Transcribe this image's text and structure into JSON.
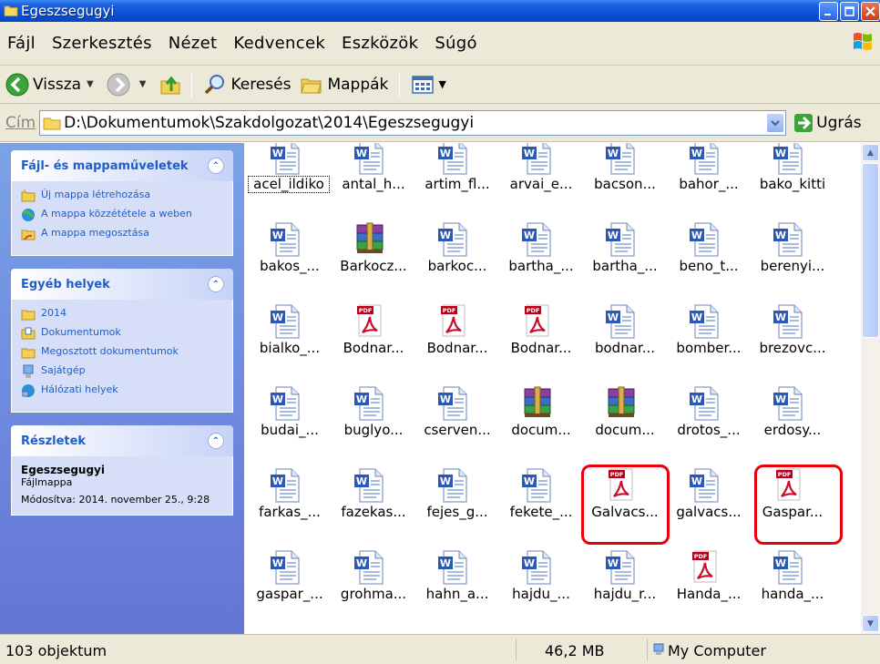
{
  "window": {
    "title": "Egeszsegugyi"
  },
  "menu": [
    "Fájl",
    "Szerkesztés",
    "Nézet",
    "Kedvencek",
    "Eszközök",
    "Súgó"
  ],
  "toolbar": {
    "back": "Vissza",
    "search": "Keresés",
    "folders": "Mappák"
  },
  "address": {
    "label": "Cím",
    "path": "D:\\Dokumentumok\\Szakdolgozat\\2014\\Egeszsegugyi",
    "go": "Ugrás"
  },
  "panels": {
    "tasks": {
      "title": "Fájl- és mappaműveletek",
      "items": [
        "Új mappa létrehozása",
        "A mappa közzététele a weben",
        "A mappa megosztása"
      ]
    },
    "places": {
      "title": "Egyéb helyek",
      "items": [
        "2014",
        "Dokumentumok",
        "Megosztott dokumentumok",
        "Sajátgép",
        "Hálózati helyek"
      ]
    },
    "details": {
      "title": "Részletek",
      "name": "Egeszsegugyi",
      "type": "Fájlmappa",
      "modified": "Módosítva: 2014. november 25., 9:28"
    }
  },
  "files": [
    {
      "name": "acel_ildiko",
      "type": "word"
    },
    {
      "name": "antal_h...",
      "type": "word"
    },
    {
      "name": "artim_fl...",
      "type": "word"
    },
    {
      "name": "arvai_e...",
      "type": "word"
    },
    {
      "name": "bacson...",
      "type": "word"
    },
    {
      "name": "bahor_...",
      "type": "word"
    },
    {
      "name": "bako_kitti",
      "type": "word"
    },
    {
      "name": "bakos_...",
      "type": "word"
    },
    {
      "name": "Barkocz...",
      "type": "rar"
    },
    {
      "name": "barkoc...",
      "type": "word"
    },
    {
      "name": "bartha_...",
      "type": "word"
    },
    {
      "name": "bartha_...",
      "type": "word"
    },
    {
      "name": "beno_t...",
      "type": "word"
    },
    {
      "name": "berenyi...",
      "type": "word"
    },
    {
      "name": "bialko_...",
      "type": "word"
    },
    {
      "name": "Bodnar...",
      "type": "pdf"
    },
    {
      "name": "Bodnar...",
      "type": "pdf"
    },
    {
      "name": "Bodnar...",
      "type": "pdf"
    },
    {
      "name": "bodnar...",
      "type": "word"
    },
    {
      "name": "bomber...",
      "type": "word"
    },
    {
      "name": "brezovc...",
      "type": "word"
    },
    {
      "name": "budai_...",
      "type": "word"
    },
    {
      "name": "buglyo...",
      "type": "word"
    },
    {
      "name": "cserven...",
      "type": "word"
    },
    {
      "name": "docum...",
      "type": "rar"
    },
    {
      "name": "docum...",
      "type": "rar"
    },
    {
      "name": "drotos_...",
      "type": "word"
    },
    {
      "name": "erdosy...",
      "type": "word"
    },
    {
      "name": "farkas_...",
      "type": "word"
    },
    {
      "name": "fazekas...",
      "type": "word"
    },
    {
      "name": "fejes_g...",
      "type": "word"
    },
    {
      "name": "fekete_...",
      "type": "word"
    },
    {
      "name": "Galvacs...",
      "type": "pdf"
    },
    {
      "name": "galvacs...",
      "type": "word"
    },
    {
      "name": "Gaspar...",
      "type": "pdf"
    },
    {
      "name": "gaspar_...",
      "type": "word"
    },
    {
      "name": "grohma...",
      "type": "word"
    },
    {
      "name": "hahn_a...",
      "type": "word"
    },
    {
      "name": "hajdu_...",
      "type": "word"
    },
    {
      "name": "hajdu_r...",
      "type": "word"
    },
    {
      "name": "Handa_...",
      "type": "pdf"
    },
    {
      "name": "handa_...",
      "type": "word"
    }
  ],
  "status": {
    "count": "103 objektum",
    "size": "46,2 MB",
    "location": "My Computer"
  }
}
